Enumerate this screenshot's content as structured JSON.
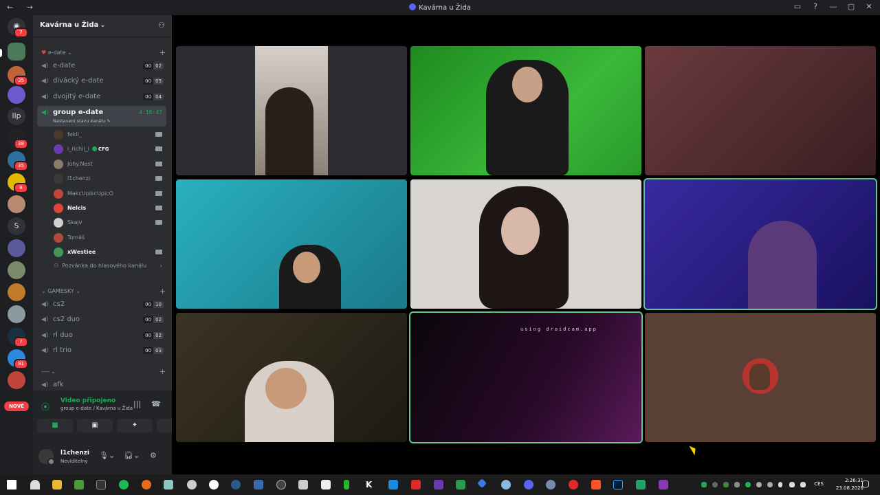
{
  "window": {
    "title": "Kavárna u Žida",
    "nav": "← →"
  },
  "server": {
    "name": "Kavárna u Žida"
  },
  "guild_badges": [
    "7",
    "35",
    "38",
    "35",
    "8",
    "7",
    "91"
  ],
  "guild_labels": {
    "llp": "llp",
    "s": "S"
  },
  "new_pill": "NOVÉ",
  "categories": [
    {
      "label": "e-date"
    },
    {
      "label": "GAMESKY"
    },
    {
      "label": "----"
    }
  ],
  "channels": {
    "edate": {
      "name": "e-date",
      "a": "00",
      "b": "02"
    },
    "divacky": {
      "name": "divácký e-date",
      "a": "00",
      "b": "03"
    },
    "dvojity": {
      "name": "dvojitý e-date",
      "a": "00",
      "b": "04"
    },
    "group": {
      "name": "group e-date",
      "timer": "4:16:47",
      "status": "Nastavení stavu kanálu"
    },
    "cs2": {
      "name": "cs2",
      "a": "00",
      "b": "10"
    },
    "cs2duo": {
      "name": "cs2 duo",
      "a": "00",
      "b": "02"
    },
    "rlduo": {
      "name": "rl duo",
      "a": "00",
      "b": "02"
    },
    "rltrio": {
      "name": "rl trio",
      "a": "00",
      "b": "03"
    },
    "afk": {
      "name": "afk"
    }
  },
  "members": [
    {
      "name": "fekli_",
      "bold": false,
      "cam": true
    },
    {
      "name": "i_richii_i",
      "bold": false,
      "cam": true,
      "tag": "CFG"
    },
    {
      "name": "Johy.Nest",
      "bold": false,
      "cam": true
    },
    {
      "name": "l1chenzi",
      "bold": false,
      "cam": true
    },
    {
      "name": "MakcUpikcUpicO",
      "bold": false,
      "cam": true
    },
    {
      "name": "Nelcis",
      "bold": true,
      "cam": true
    },
    {
      "name": "Skajv",
      "bold": false,
      "cam": true
    },
    {
      "name": "Tomáš",
      "bold": false,
      "cam": false
    },
    {
      "name": "xWestiee",
      "bold": true,
      "cam": true
    }
  ],
  "invite": "Pozvánka do hlasového kanálu",
  "voice": {
    "status": "Video připojeno",
    "sub": "group e-date / Kavárna u Žida"
  },
  "user": {
    "name": "l1chenzi",
    "status": "Neviditelný"
  },
  "droidcam_text": "using droidcam.app",
  "tray": {
    "time": "2:26:31",
    "date": "23.08.2026",
    "lang": "CES"
  },
  "colors": {
    "speaking_outline": "#63c98a",
    "online_green": "#23a55a",
    "mention_red": "#f23f43"
  }
}
